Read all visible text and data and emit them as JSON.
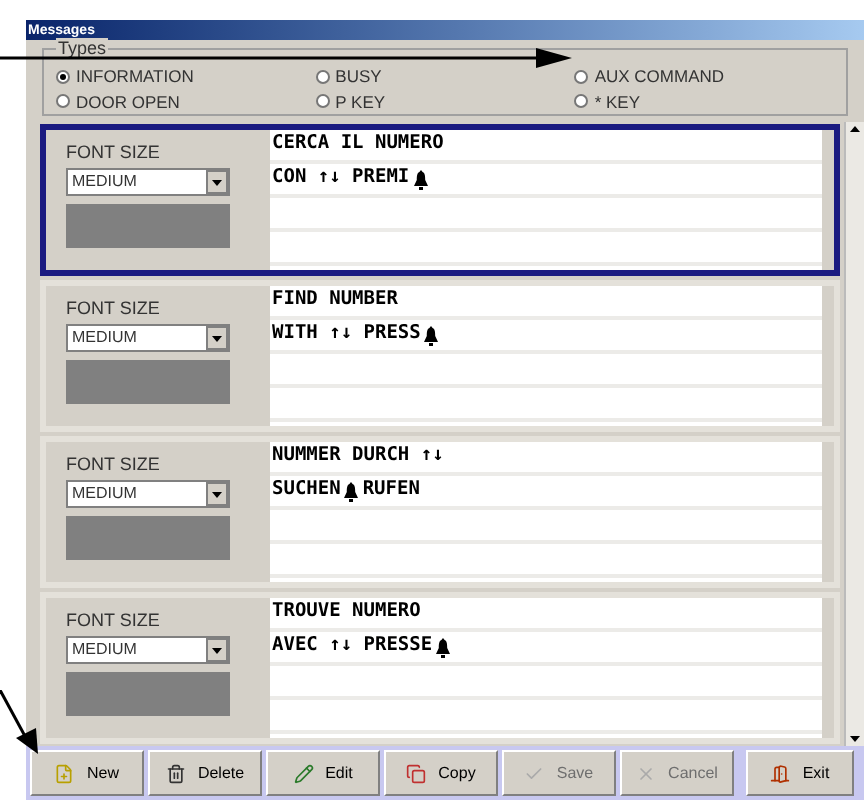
{
  "window": {
    "title": "Messages"
  },
  "types": {
    "label": "Types",
    "options": [
      {
        "label": "INFORMATION",
        "selected": true
      },
      {
        "label": "BUSY",
        "selected": false
      },
      {
        "label": "AUX COMMAND",
        "selected": false
      },
      {
        "label": "DOOR OPEN",
        "selected": false
      },
      {
        "label": "P KEY",
        "selected": false
      },
      {
        "label": "* KEY",
        "selected": false
      }
    ]
  },
  "messages": [
    {
      "selected": true,
      "font_size_label": "FONT SIZE",
      "font_size": "MEDIUM",
      "lines": [
        [
          {
            "kind": "text",
            "text": "CERCA IL NUMERO"
          }
        ],
        [
          {
            "kind": "text",
            "text": "CON ↑↓ PREMI"
          },
          {
            "kind": "bell"
          }
        ]
      ]
    },
    {
      "selected": false,
      "font_size_label": "FONT SIZE",
      "font_size": "MEDIUM",
      "lines": [
        [
          {
            "kind": "text",
            "text": "FIND NUMBER"
          }
        ],
        [
          {
            "kind": "text",
            "text": "WITH ↑↓ PRESS"
          },
          {
            "kind": "bell"
          }
        ]
      ]
    },
    {
      "selected": false,
      "font_size_label": "FONT SIZE",
      "font_size": "MEDIUM",
      "lines": [
        [
          {
            "kind": "text",
            "text": "NUMMER DURCH ↑↓"
          }
        ],
        [
          {
            "kind": "text",
            "text": "SUCHEN"
          },
          {
            "kind": "bell"
          },
          {
            "kind": "text",
            "text": "RUFEN"
          }
        ]
      ]
    },
    {
      "selected": false,
      "font_size_label": "FONT SIZE",
      "font_size": "MEDIUM",
      "lines": [
        [
          {
            "kind": "text",
            "text": "TROUVE NUMERO"
          }
        ],
        [
          {
            "kind": "text",
            "text": "AVEC ↑↓ PRESSE"
          },
          {
            "kind": "bell"
          }
        ]
      ]
    }
  ],
  "toolbar": [
    {
      "kind": "new",
      "label": "New",
      "disabled": false
    },
    {
      "kind": "delete",
      "label": "Delete",
      "disabled": false
    },
    {
      "kind": "edit",
      "label": "Edit",
      "disabled": false
    },
    {
      "kind": "copy",
      "label": "Copy",
      "disabled": false
    },
    {
      "kind": "save",
      "label": "Save",
      "disabled": true
    },
    {
      "kind": "cancel",
      "label": "Cancel",
      "disabled": true
    },
    {
      "kind": "exit",
      "label": "Exit",
      "disabled": false
    }
  ]
}
